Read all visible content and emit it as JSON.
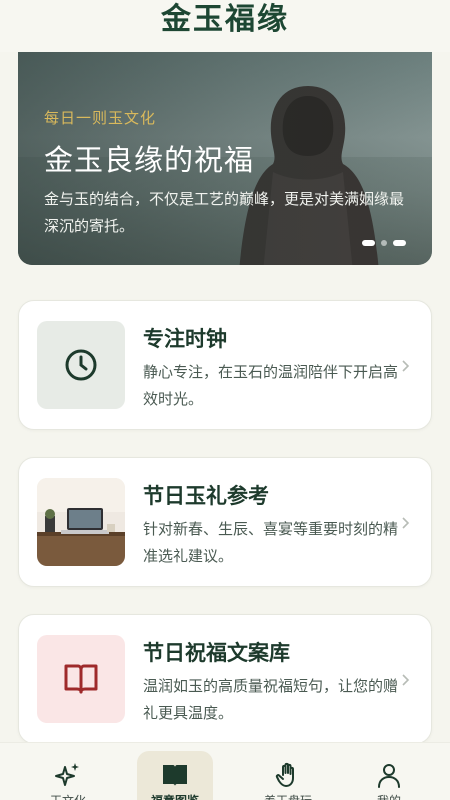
{
  "app": {
    "title": "金玉福缘"
  },
  "hero": {
    "kicker": "每日一则玉文化",
    "title": "金玉良缘的祝福",
    "description": "金与玉的结合，不仅是工艺的巅峰，更是对美满姻缘最深沉的寄托。",
    "carousel": {
      "total": 3,
      "active": 2
    }
  },
  "cards": [
    {
      "title": "专注时钟",
      "description": "静心专注，在玉石的温润陪伴下开启高效时光。",
      "icon": "clock-icon"
    },
    {
      "title": "节日玉礼参考",
      "description": "针对新春、生辰、喜宴等重要时刻的精准选礼建议。",
      "icon": "desk-photo"
    },
    {
      "title": "节日祝福文案库",
      "description": "温润如玉的高质量祝福短句，让您的赠礼更具温度。",
      "icon": "book-icon"
    }
  ],
  "tabs": [
    {
      "label": "玉文化",
      "icon": "sparkle-icon",
      "active": false
    },
    {
      "label": "福意图鉴",
      "icon": "book-open-icon",
      "active": true
    },
    {
      "label": "养玉盘玩",
      "icon": "hand-icon",
      "active": false
    },
    {
      "label": "我的",
      "icon": "user-icon",
      "active": false
    }
  ],
  "colors": {
    "brand_green": "#1d4733",
    "accent_gold": "#d9b95c",
    "background": "#f5f5ee",
    "book_red": "#9e2a2b"
  }
}
